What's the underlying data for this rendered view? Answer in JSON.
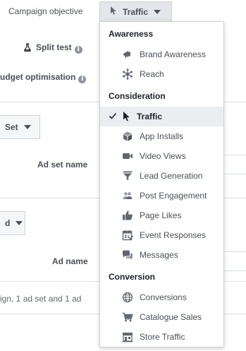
{
  "form": {
    "campaign_objective_label": "Campaign objective",
    "split_test_label": "Split test",
    "budget_optimisation_label": "udget optimisation",
    "ad_set_button_label": "Set",
    "ad_set_name_label": "Ad set name",
    "ad_button_label": "d",
    "ad_name_label": "Ad name",
    "summary_text": "ign, 1 ad set and 1 ad",
    "info_glyph": "i"
  },
  "objective_dropdown": {
    "selected_label": "Traffic",
    "groups": [
      {
        "header": "Awareness",
        "items": [
          {
            "label": "Brand Awareness",
            "icon": "megaphone-icon"
          },
          {
            "label": "Reach",
            "icon": "reach-icon"
          }
        ]
      },
      {
        "header": "Consideration",
        "items": [
          {
            "label": "Traffic",
            "icon": "cursor-icon",
            "selected": true
          },
          {
            "label": "App Installs",
            "icon": "box-icon"
          },
          {
            "label": "Video Views",
            "icon": "video-camera-icon"
          },
          {
            "label": "Lead Generation",
            "icon": "funnel-icon"
          },
          {
            "label": "Post Engagement",
            "icon": "people-icon"
          },
          {
            "label": "Page Likes",
            "icon": "thumbs-up-icon"
          },
          {
            "label": "Event Responses",
            "icon": "calendar-icon"
          },
          {
            "label": "Messages",
            "icon": "chat-bubbles-icon"
          }
        ]
      },
      {
        "header": "Conversion",
        "items": [
          {
            "label": "Conversions",
            "icon": "globe-icon"
          },
          {
            "label": "Catalogue Sales",
            "icon": "shopping-cart-icon"
          },
          {
            "label": "Store Traffic",
            "icon": "store-icon"
          }
        ]
      }
    ]
  },
  "colors": {
    "menu_border": "#ccd0d5",
    "selected_bg": "#ebedf0",
    "icon_gray": "#606770",
    "text": "#4b4f56"
  }
}
